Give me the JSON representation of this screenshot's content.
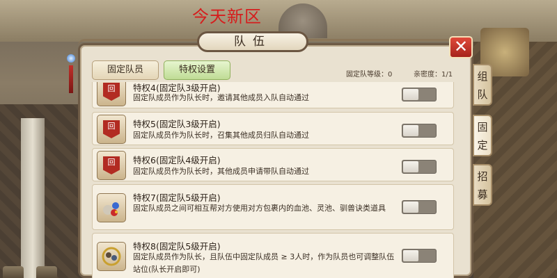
{
  "watermark": "今天新区",
  "dialog": {
    "title": "队伍",
    "close_label": "✕"
  },
  "tabs": {
    "fixed_member": "固定队员",
    "privilege_settings": "特权设置"
  },
  "meta": {
    "team_level": "固定队等级：0",
    "intimacy": "亲密度：1/1"
  },
  "side_tabs": [
    {
      "label": "组\n队"
    },
    {
      "label": "固\n定"
    },
    {
      "label": "招\n募"
    }
  ],
  "privileges": [
    {
      "title": "特权4(固定队3级开启)",
      "desc": "固定队成员作为队长时，邀请其他成员入队自动通过",
      "icon": "red-flag-icon",
      "enabled": false
    },
    {
      "title": "特权5(固定队3级开启)",
      "desc": "固定队成员作为队长时，召集其他成员归队自动通过",
      "icon": "red-flag-icon",
      "enabled": false
    },
    {
      "title": "特权6(固定队4级开启)",
      "desc": "固定队成员作为队长时，其他成员申请带队自动通过",
      "icon": "red-flag-icon",
      "enabled": false
    },
    {
      "title": "特权7(固定队5级开启)",
      "desc": "固定队成员之间可相互帮对方使用对方包裹内的血池、灵池、驯兽诀类道具",
      "icon": "potion-items-icon",
      "enabled": false
    },
    {
      "title": "特权8(固定队5级开启)",
      "desc": "固定队成员作为队长，且队伍中固定队成员 ≥ 3人时，作为队员也可调整队伍站位(队长开启即可)",
      "icon": "swap-members-icon",
      "enabled": false
    }
  ],
  "colors": {
    "title_red": "#d61d1d",
    "close_red": "#c8362a",
    "active_tab_green": "#bfdc95"
  }
}
